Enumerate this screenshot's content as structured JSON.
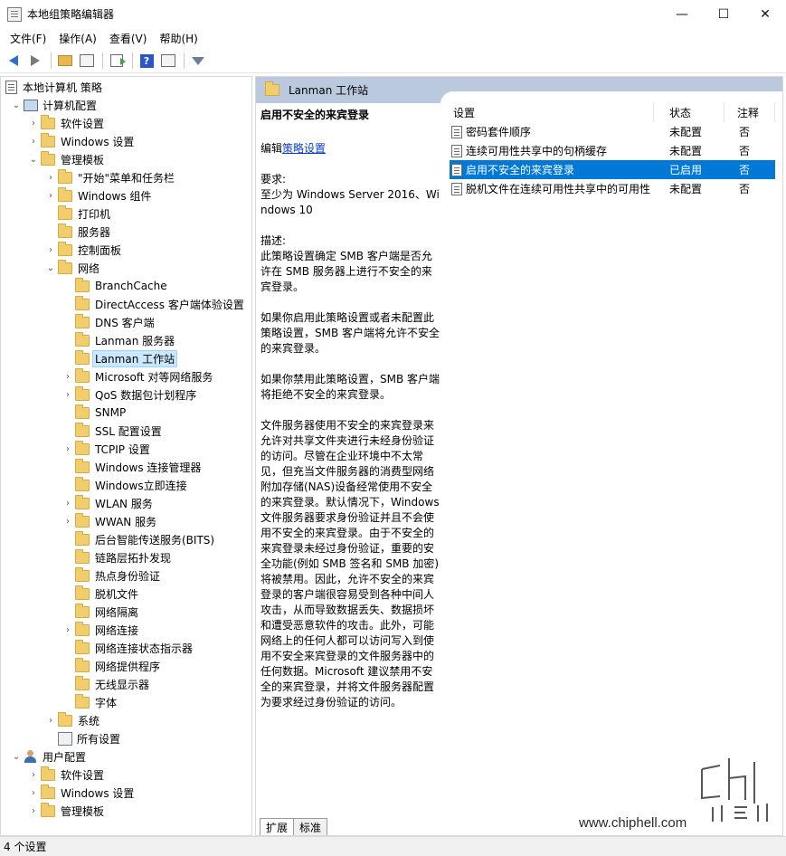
{
  "window": {
    "title": "本地组策略编辑器",
    "controls": {
      "minimize": "—",
      "maximize": "☐",
      "close": "✕"
    }
  },
  "menu": [
    "文件(F)",
    "操作(A)",
    "查看(V)",
    "帮助(H)"
  ],
  "toolbar": {
    "icons": [
      "back-arrow-icon",
      "forward-arrow-icon",
      "folder-up-icon",
      "show-hide-tree-icon",
      "export-list-icon",
      "help-icon",
      "properties-icon",
      "filter-icon"
    ],
    "help_glyph": "?"
  },
  "tree": [
    {
      "label": "本地计算机 策略",
      "indent": 0,
      "expander": "",
      "icon": "doc"
    },
    {
      "label": "计算机配置",
      "indent": 1,
      "expander": "⌄",
      "icon": "pc"
    },
    {
      "label": "软件设置",
      "indent": 2,
      "expander": "›",
      "icon": "folder"
    },
    {
      "label": "Windows 设置",
      "indent": 2,
      "expander": "›",
      "icon": "folder"
    },
    {
      "label": "管理模板",
      "indent": 2,
      "expander": "⌄",
      "icon": "folder"
    },
    {
      "label": "\"开始\"菜单和任务栏",
      "indent": 3,
      "expander": "›",
      "icon": "folder"
    },
    {
      "label": "Windows 组件",
      "indent": 3,
      "expander": "›",
      "icon": "folder"
    },
    {
      "label": "打印机",
      "indent": 3,
      "expander": "",
      "icon": "folder"
    },
    {
      "label": "服务器",
      "indent": 3,
      "expander": "",
      "icon": "folder"
    },
    {
      "label": "控制面板",
      "indent": 3,
      "expander": "›",
      "icon": "folder"
    },
    {
      "label": "网络",
      "indent": 3,
      "expander": "⌄",
      "icon": "folder"
    },
    {
      "label": "BranchCache",
      "indent": 4,
      "expander": "",
      "icon": "folder"
    },
    {
      "label": "DirectAccess 客户端体验设置",
      "indent": 4,
      "expander": "",
      "icon": "folder"
    },
    {
      "label": "DNS 客户端",
      "indent": 4,
      "expander": "",
      "icon": "folder"
    },
    {
      "label": "Lanman 服务器",
      "indent": 4,
      "expander": "",
      "icon": "folder"
    },
    {
      "label": "Lanman 工作站",
      "indent": 4,
      "expander": "",
      "icon": "folder",
      "selected": true
    },
    {
      "label": "Microsoft 对等网络服务",
      "indent": 4,
      "expander": "›",
      "icon": "folder"
    },
    {
      "label": "QoS 数据包计划程序",
      "indent": 4,
      "expander": "›",
      "icon": "folder"
    },
    {
      "label": "SNMP",
      "indent": 4,
      "expander": "",
      "icon": "folder"
    },
    {
      "label": "SSL 配置设置",
      "indent": 4,
      "expander": "",
      "icon": "folder"
    },
    {
      "label": "TCPIP 设置",
      "indent": 4,
      "expander": "›",
      "icon": "folder"
    },
    {
      "label": "Windows 连接管理器",
      "indent": 4,
      "expander": "",
      "icon": "folder"
    },
    {
      "label": "Windows立即连接",
      "indent": 4,
      "expander": "",
      "icon": "folder"
    },
    {
      "label": "WLAN 服务",
      "indent": 4,
      "expander": "›",
      "icon": "folder"
    },
    {
      "label": "WWAN 服务",
      "indent": 4,
      "expander": "›",
      "icon": "folder"
    },
    {
      "label": "后台智能传送服务(BITS)",
      "indent": 4,
      "expander": "",
      "icon": "folder"
    },
    {
      "label": "链路层拓扑发现",
      "indent": 4,
      "expander": "",
      "icon": "folder"
    },
    {
      "label": "热点身份验证",
      "indent": 4,
      "expander": "",
      "icon": "folder"
    },
    {
      "label": "脱机文件",
      "indent": 4,
      "expander": "",
      "icon": "folder"
    },
    {
      "label": "网络隔离",
      "indent": 4,
      "expander": "",
      "icon": "folder"
    },
    {
      "label": "网络连接",
      "indent": 4,
      "expander": "›",
      "icon": "folder"
    },
    {
      "label": "网络连接状态指示器",
      "indent": 4,
      "expander": "",
      "icon": "folder"
    },
    {
      "label": "网络提供程序",
      "indent": 4,
      "expander": "",
      "icon": "folder"
    },
    {
      "label": "无线显示器",
      "indent": 4,
      "expander": "",
      "icon": "folder"
    },
    {
      "label": "字体",
      "indent": 4,
      "expander": "",
      "icon": "folder"
    },
    {
      "label": "系统",
      "indent": 3,
      "expander": "›",
      "icon": "folder"
    },
    {
      "label": "所有设置",
      "indent": 3,
      "expander": "",
      "icon": "allset"
    },
    {
      "label": "用户配置",
      "indent": 1,
      "expander": "⌄",
      "icon": "user"
    },
    {
      "label": "软件设置",
      "indent": 2,
      "expander": "›",
      "icon": "folder"
    },
    {
      "label": "Windows 设置",
      "indent": 2,
      "expander": "›",
      "icon": "folder"
    },
    {
      "label": "管理模板",
      "indent": 2,
      "expander": "›",
      "icon": "folder"
    }
  ],
  "right": {
    "header_title": "Lanman 工作站",
    "description": {
      "title": "启用不安全的来宾登录",
      "edit_prefix": "编辑",
      "edit_link": "策略设置",
      "req_label": "要求:",
      "req_text": "至少为 Windows Server 2016、Windows 10",
      "desc_label": "描述:",
      "para1": "此策略设置确定 SMB 客户端是否允许在 SMB 服务器上进行不安全的来宾登录。",
      "para2": "如果你启用此策略设置或者未配置此策略设置，SMB 客户端将允许不安全的来宾登录。",
      "para3": "如果你禁用此策略设置，SMB 客户端将拒绝不安全的来宾登录。",
      "para4": "文件服务器使用不安全的来宾登录来允许对共享文件夹进行未经身份验证的访问。尽管在企业环境中不太常见，但充当文件服务器的消费型网络附加存储(NAS)设备经常使用不安全的来宾登录。默认情况下，Windows 文件服务器要求身份验证并且不会使用不安全的来宾登录。由于不安全的来宾登录未经过身份验证，重要的安全功能(例如 SMB 签名和 SMB 加密)将被禁用。因此，允许不安全的来宾登录的客户端很容易受到各种中间人攻击，从而导致数据丢失、数据损坏和遭受恶意软件的攻击。此外，可能网络上的任何人都可以访问写入到使用不安全来宾登录的文件服务器中的任何数据。Microsoft 建议禁用不安全的来宾登录，并将文件服务器配置为要求经过身份验证的访问。"
    },
    "list": {
      "columns": [
        "设置",
        "状态",
        "注释"
      ],
      "rows": [
        {
          "name": "密码套件顺序",
          "state": "未配置",
          "note": "否"
        },
        {
          "name": "连续可用性共享中的句柄缓存",
          "state": "未配置",
          "note": "否"
        },
        {
          "name": "启用不安全的来宾登录",
          "state": "已启用",
          "note": "否",
          "selected": true
        },
        {
          "name": "脱机文件在连续可用性共享中的可用性",
          "state": "未配置",
          "note": "否"
        }
      ]
    },
    "tabs": [
      "扩展",
      "标准"
    ]
  },
  "status": "4 个设置",
  "watermark": {
    "text": "www.chiphell.com",
    "logo_word": "chiphell"
  }
}
